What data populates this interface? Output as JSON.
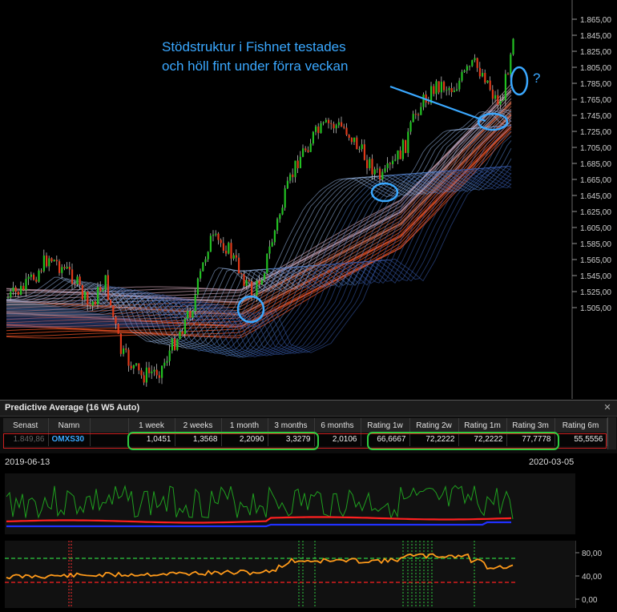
{
  "annotation": {
    "line1": "Stödstruktur i Fishnet testades",
    "line2": "och höll fint under förra veckan",
    "question": "?",
    "color": "#3aa8ff"
  },
  "price_axis": {
    "labels": [
      "1.865,00",
      "1.845,00",
      "1.825,00",
      "1.805,00",
      "1.785,00",
      "1.765,00",
      "1.745,00",
      "1.725,00",
      "1.705,00",
      "1.685,00",
      "1.665,00",
      "1.645,00",
      "1.625,00",
      "1.605,00",
      "1.585,00",
      "1.565,00",
      "1.545,00",
      "1.525,00",
      "1.505,00"
    ]
  },
  "panel": {
    "title": "Predictive Average (16  W5 Auto)",
    "close_icon": "close-icon"
  },
  "table": {
    "headers": [
      "Senast",
      "Namn",
      "",
      "1 week",
      "2 weeks",
      "1 month",
      "3 months",
      "6 months",
      "Rating 1w",
      "Rating 2w",
      "Rating 1m",
      "Rating 3m",
      "Rating 6m"
    ],
    "row": [
      "1.849,86",
      "OMXS30",
      "",
      "1,0451",
      "1,3568",
      "2,2090",
      "3,3279",
      "2,0106",
      "66,6667",
      "72,2222",
      "72,2222",
      "77,7778",
      "55,5556"
    ]
  },
  "dates": {
    "start": "2019-06-13",
    "end": "2020-03-05"
  },
  "osc2_axis": {
    "labels": [
      "80,00",
      "40,00",
      "0,00"
    ]
  },
  "colors": {
    "bull": "#22c022",
    "bear": "#e03a1a",
    "ribbon_blue": "#4a7fd0",
    "ribbon_red": "#e05a3a",
    "highlight_green": "#2ecc40",
    "row_outline": "#d02020"
  }
}
